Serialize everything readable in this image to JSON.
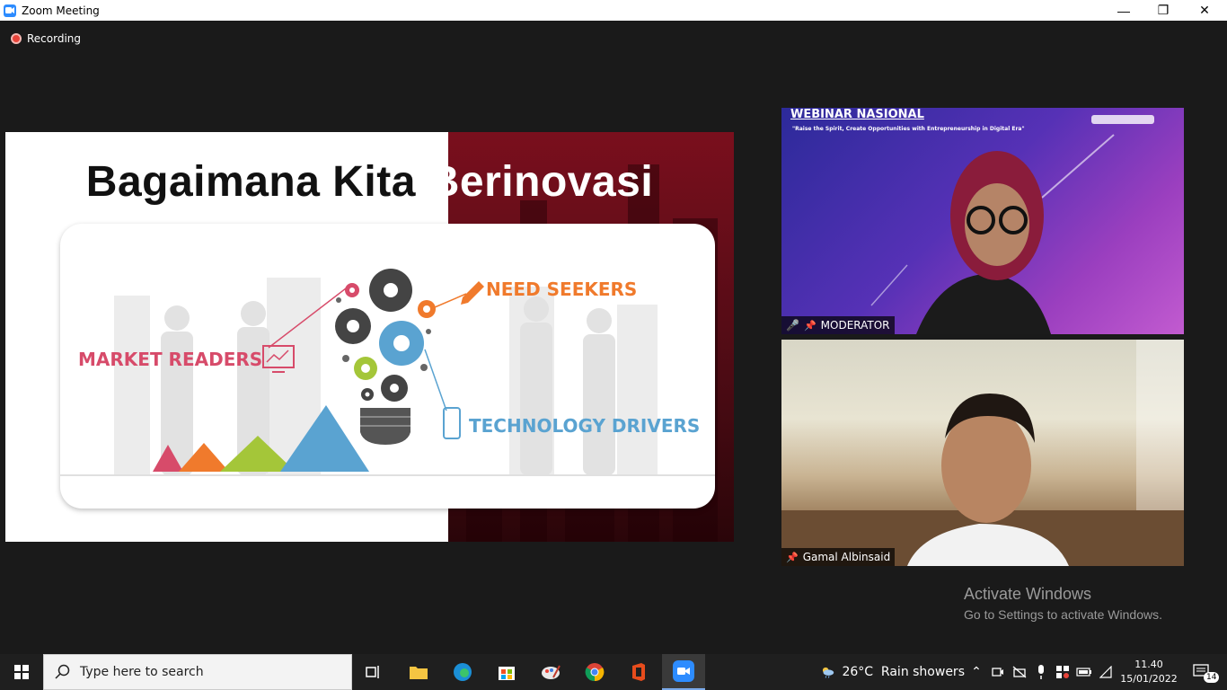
{
  "window": {
    "title": "Zoom Meeting",
    "minimize": "—",
    "restore": "❐",
    "close": "✕"
  },
  "recording": {
    "label": "Recording"
  },
  "slide": {
    "title_left": "Bagaimana Kita",
    "title_right": "Berinovasi",
    "labels": {
      "market": "MARKET READERS",
      "need": "NEED SEEKERS",
      "tech": "TECHNOLOGY DRIVERS"
    }
  },
  "videos": {
    "moderator": {
      "name": "MODERATOR",
      "banner_title": "WEBINAR NASIONAL",
      "banner_sub": "\"Raise the Spirit, Create Opportunities with Entrepreneurship in Digital Era\""
    },
    "speaker": {
      "name": "Gamal Albinsaid"
    }
  },
  "watermark": {
    "line1": "Activate Windows",
    "line2": "Go to Settings to activate Windows."
  },
  "taskbar": {
    "search_placeholder": "Type here to search",
    "weather": "26°C  Rain showers",
    "time": "11.40",
    "date": "15/01/2022",
    "notifications": "14"
  },
  "colors": {
    "zoom_blue": "#2d8cff",
    "market": "#d74b6a",
    "need": "#f07a2c",
    "tech": "#5aa3d1"
  }
}
